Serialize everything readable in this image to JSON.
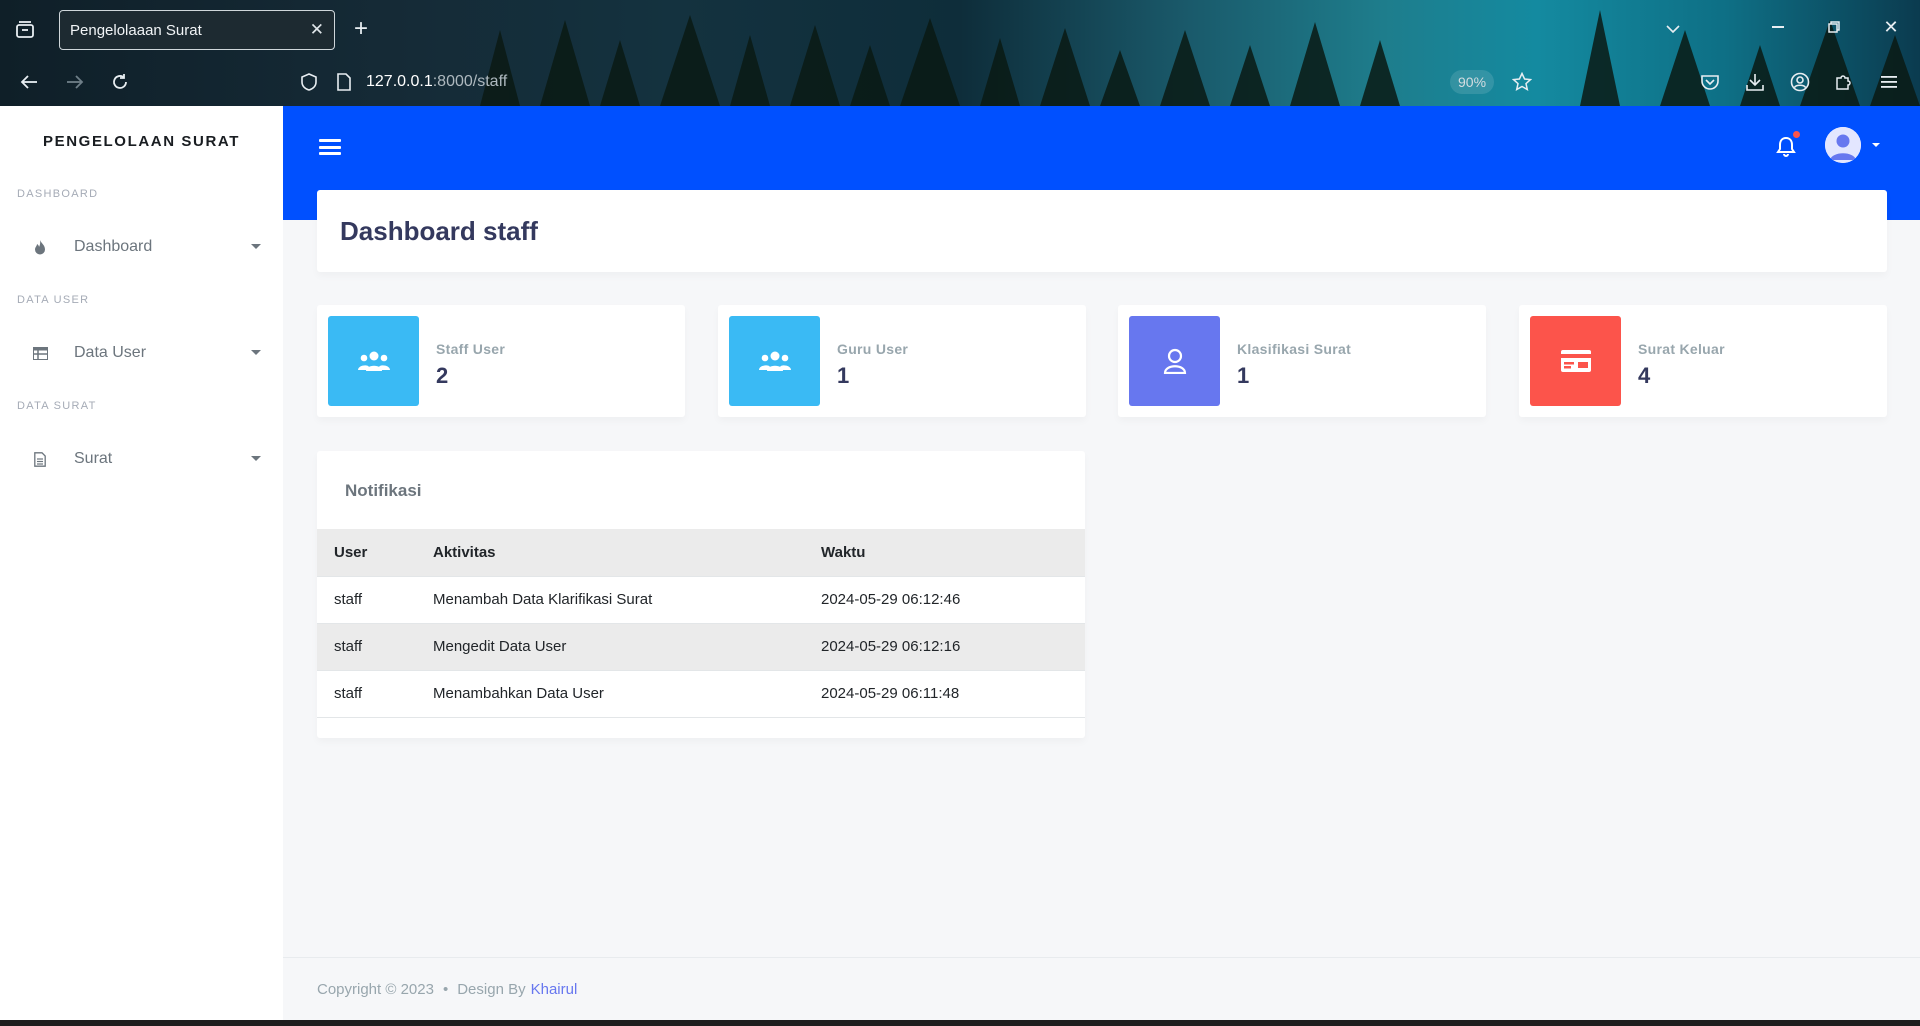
{
  "browser": {
    "tab_title": "Pengelolaaan Surat",
    "url_host": "127.0.0.1",
    "url_rest": ":8000/staff",
    "zoom": "90%"
  },
  "sidebar": {
    "brand": "PENGELOLAAN SURAT",
    "sections": [
      {
        "header": "DASHBOARD",
        "item": "Dashboard",
        "icon": "fire-icon"
      },
      {
        "header": "DATA USER",
        "item": "Data User",
        "icon": "table-icon"
      },
      {
        "header": "DATA SURAT",
        "item": "Surat",
        "icon": "file-icon"
      }
    ]
  },
  "header": {
    "title": "Dashboard staff"
  },
  "stats": [
    {
      "label": "Staff User",
      "value": "2",
      "color": "#3abaf4",
      "icon": "users-icon"
    },
    {
      "label": "Guru User",
      "value": "1",
      "color": "#3abaf4",
      "icon": "users-icon"
    },
    {
      "label": "Klasifikasi Surat",
      "value": "1",
      "color": "#6777ef",
      "icon": "user-icon"
    },
    {
      "label": "Surat Keluar",
      "value": "4",
      "color": "#fc544b",
      "icon": "card-icon"
    }
  ],
  "notifikasi": {
    "title": "Notifikasi",
    "columns": [
      "User",
      "Aktivitas",
      "Waktu"
    ],
    "rows": [
      {
        "user": "staff",
        "aktivitas": "Menambah Data Klarifikasi Surat",
        "waktu": "2024-05-29 06:12:46"
      },
      {
        "user": "staff",
        "aktivitas": "Mengedit Data User",
        "waktu": "2024-05-29 06:12:16"
      },
      {
        "user": "staff",
        "aktivitas": "Menambahkan Data User",
        "waktu": "2024-05-29 06:11:48"
      }
    ]
  },
  "footer": {
    "copyright": "Copyright © 2023",
    "separator": "•",
    "design_by": "Design By",
    "author": "Khairul"
  },
  "colors": {
    "topbar": "#0050ff",
    "accent": "#6777ef",
    "info": "#3abaf4",
    "danger": "#fc544b"
  }
}
